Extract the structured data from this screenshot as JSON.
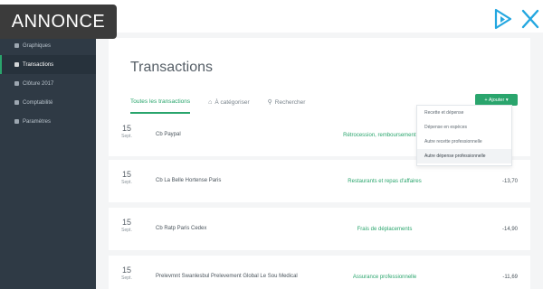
{
  "ad": {
    "label": "ANNONCE",
    "accent": "#23a7e0"
  },
  "sidebar": {
    "items": [
      {
        "label": "Graphiques",
        "icon": "chart-icon",
        "active": false
      },
      {
        "label": "Transactions",
        "icon": "list-icon",
        "active": true
      },
      {
        "label": "Clôture 2017",
        "icon": "calendar-icon",
        "active": false
      },
      {
        "label": "Comptabilité",
        "icon": "book-icon",
        "active": false
      },
      {
        "label": "Paramètres",
        "icon": "settings-icon",
        "active": false
      }
    ]
  },
  "main": {
    "title": "Transactions",
    "tabs": [
      {
        "label": "Toutes les transactions",
        "active": true
      },
      {
        "label": "À catégoriser",
        "icon": "tag-icon",
        "active": false
      },
      {
        "label": "Rechercher",
        "icon": "search-icon",
        "active": false
      }
    ],
    "add_button": "+ Ajouter ▾"
  },
  "dropdown": {
    "items": [
      {
        "label": "Recette et dépense"
      },
      {
        "label": "Dépense en espèces"
      },
      {
        "label": "Autre recette professionnelle"
      },
      {
        "label": "Autre dépense professionnelle",
        "highlighted": true
      }
    ]
  },
  "transactions": [
    {
      "day": "15",
      "month": "Sept.",
      "description": "Cb Paypal",
      "category": "Rétrocession, remboursement, ind",
      "amount": ""
    },
    {
      "day": "15",
      "month": "Sept.",
      "description": "Cb La Belle Hortense Paris",
      "category": "Restaurants et repas d'affaires",
      "amount": "-13,70"
    },
    {
      "day": "15",
      "month": "Sept.",
      "description": "Cb Ratp Paris Cedex",
      "category": "Frais de déplacements",
      "amount": "-14,90"
    },
    {
      "day": "15",
      "month": "Sept.",
      "description": "Prelevmnt Swanlesbul Prelevement Global Le Sou Medical",
      "category": "Assurance professionnelle",
      "amount": "-11,69"
    }
  ],
  "colors": {
    "accent_green": "#2aa56d",
    "sidebar_bg": "#2f3a45"
  }
}
